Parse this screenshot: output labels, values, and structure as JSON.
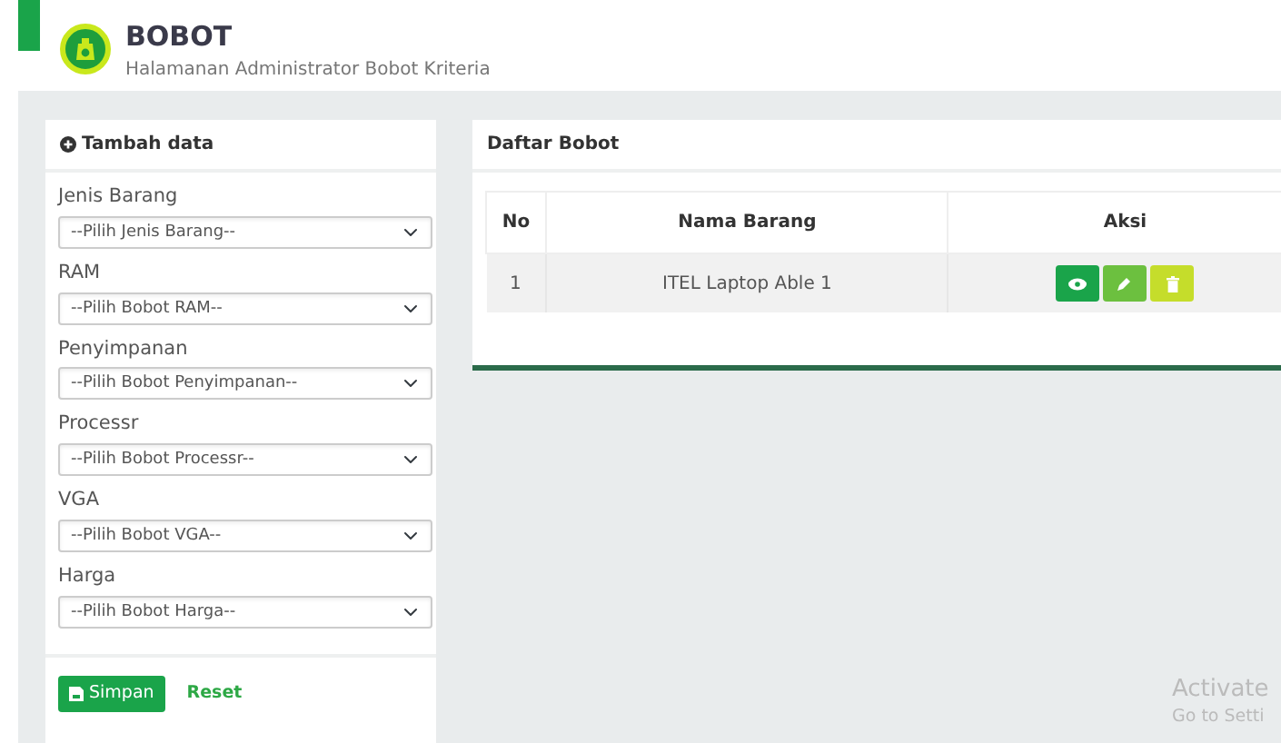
{
  "header": {
    "title": "BOBOT",
    "subtitle": "Halamanan Administrator Bobot Kriteria"
  },
  "form_card": {
    "title": "Tambah data",
    "fields": [
      {
        "label": "Jenis Barang",
        "placeholder": "--Pilih Jenis Barang--"
      },
      {
        "label": "RAM",
        "placeholder": "--Pilih Bobot RAM--"
      },
      {
        "label": "Penyimpanan",
        "placeholder": "--Pilih Bobot Penyimpanan--"
      },
      {
        "label": "Processr",
        "placeholder": "--Pilih Bobot Processr--"
      },
      {
        "label": "VGA",
        "placeholder": "--Pilih Bobot VGA--"
      },
      {
        "label": "Harga",
        "placeholder": "--Pilih Bobot Harga--"
      }
    ],
    "buttons": [
      {
        "kind": "save",
        "label": "Simpan"
      },
      {
        "kind": "reset",
        "label": "Reset"
      }
    ]
  },
  "list_card": {
    "title": "Daftar Bobot",
    "table": {
      "columns": [
        "No",
        "Nama Barang",
        "Aksi"
      ],
      "rows": [
        {
          "no": "1",
          "name": "ITEL Laptop Able 1",
          "actions": [
            {
              "kind": "view"
            },
            {
              "kind": "edit"
            },
            {
              "kind": "delete"
            }
          ]
        }
      ]
    }
  },
  "os_notice": {
    "title": "Activate",
    "subtitle": "Go to Setti"
  }
}
